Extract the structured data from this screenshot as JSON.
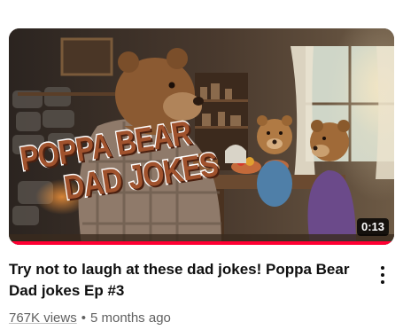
{
  "video": {
    "thumbnail_overlay": {
      "line1": "POPPA BEAR",
      "line2": "DAD JOKES"
    },
    "duration": "0:13",
    "watch_progress": 1.0,
    "title": "Try not to laugh at these dad jokes! Poppa Bear Dad jokes Ep #3",
    "views": "767K views",
    "separator": "•",
    "published": "5 months ago",
    "menu_icon": "more-vert-icon"
  },
  "colors": {
    "progress": "#ff0033",
    "overlay_text": "#a0522d",
    "title": "#0f0f0f",
    "meta": "#606060"
  }
}
